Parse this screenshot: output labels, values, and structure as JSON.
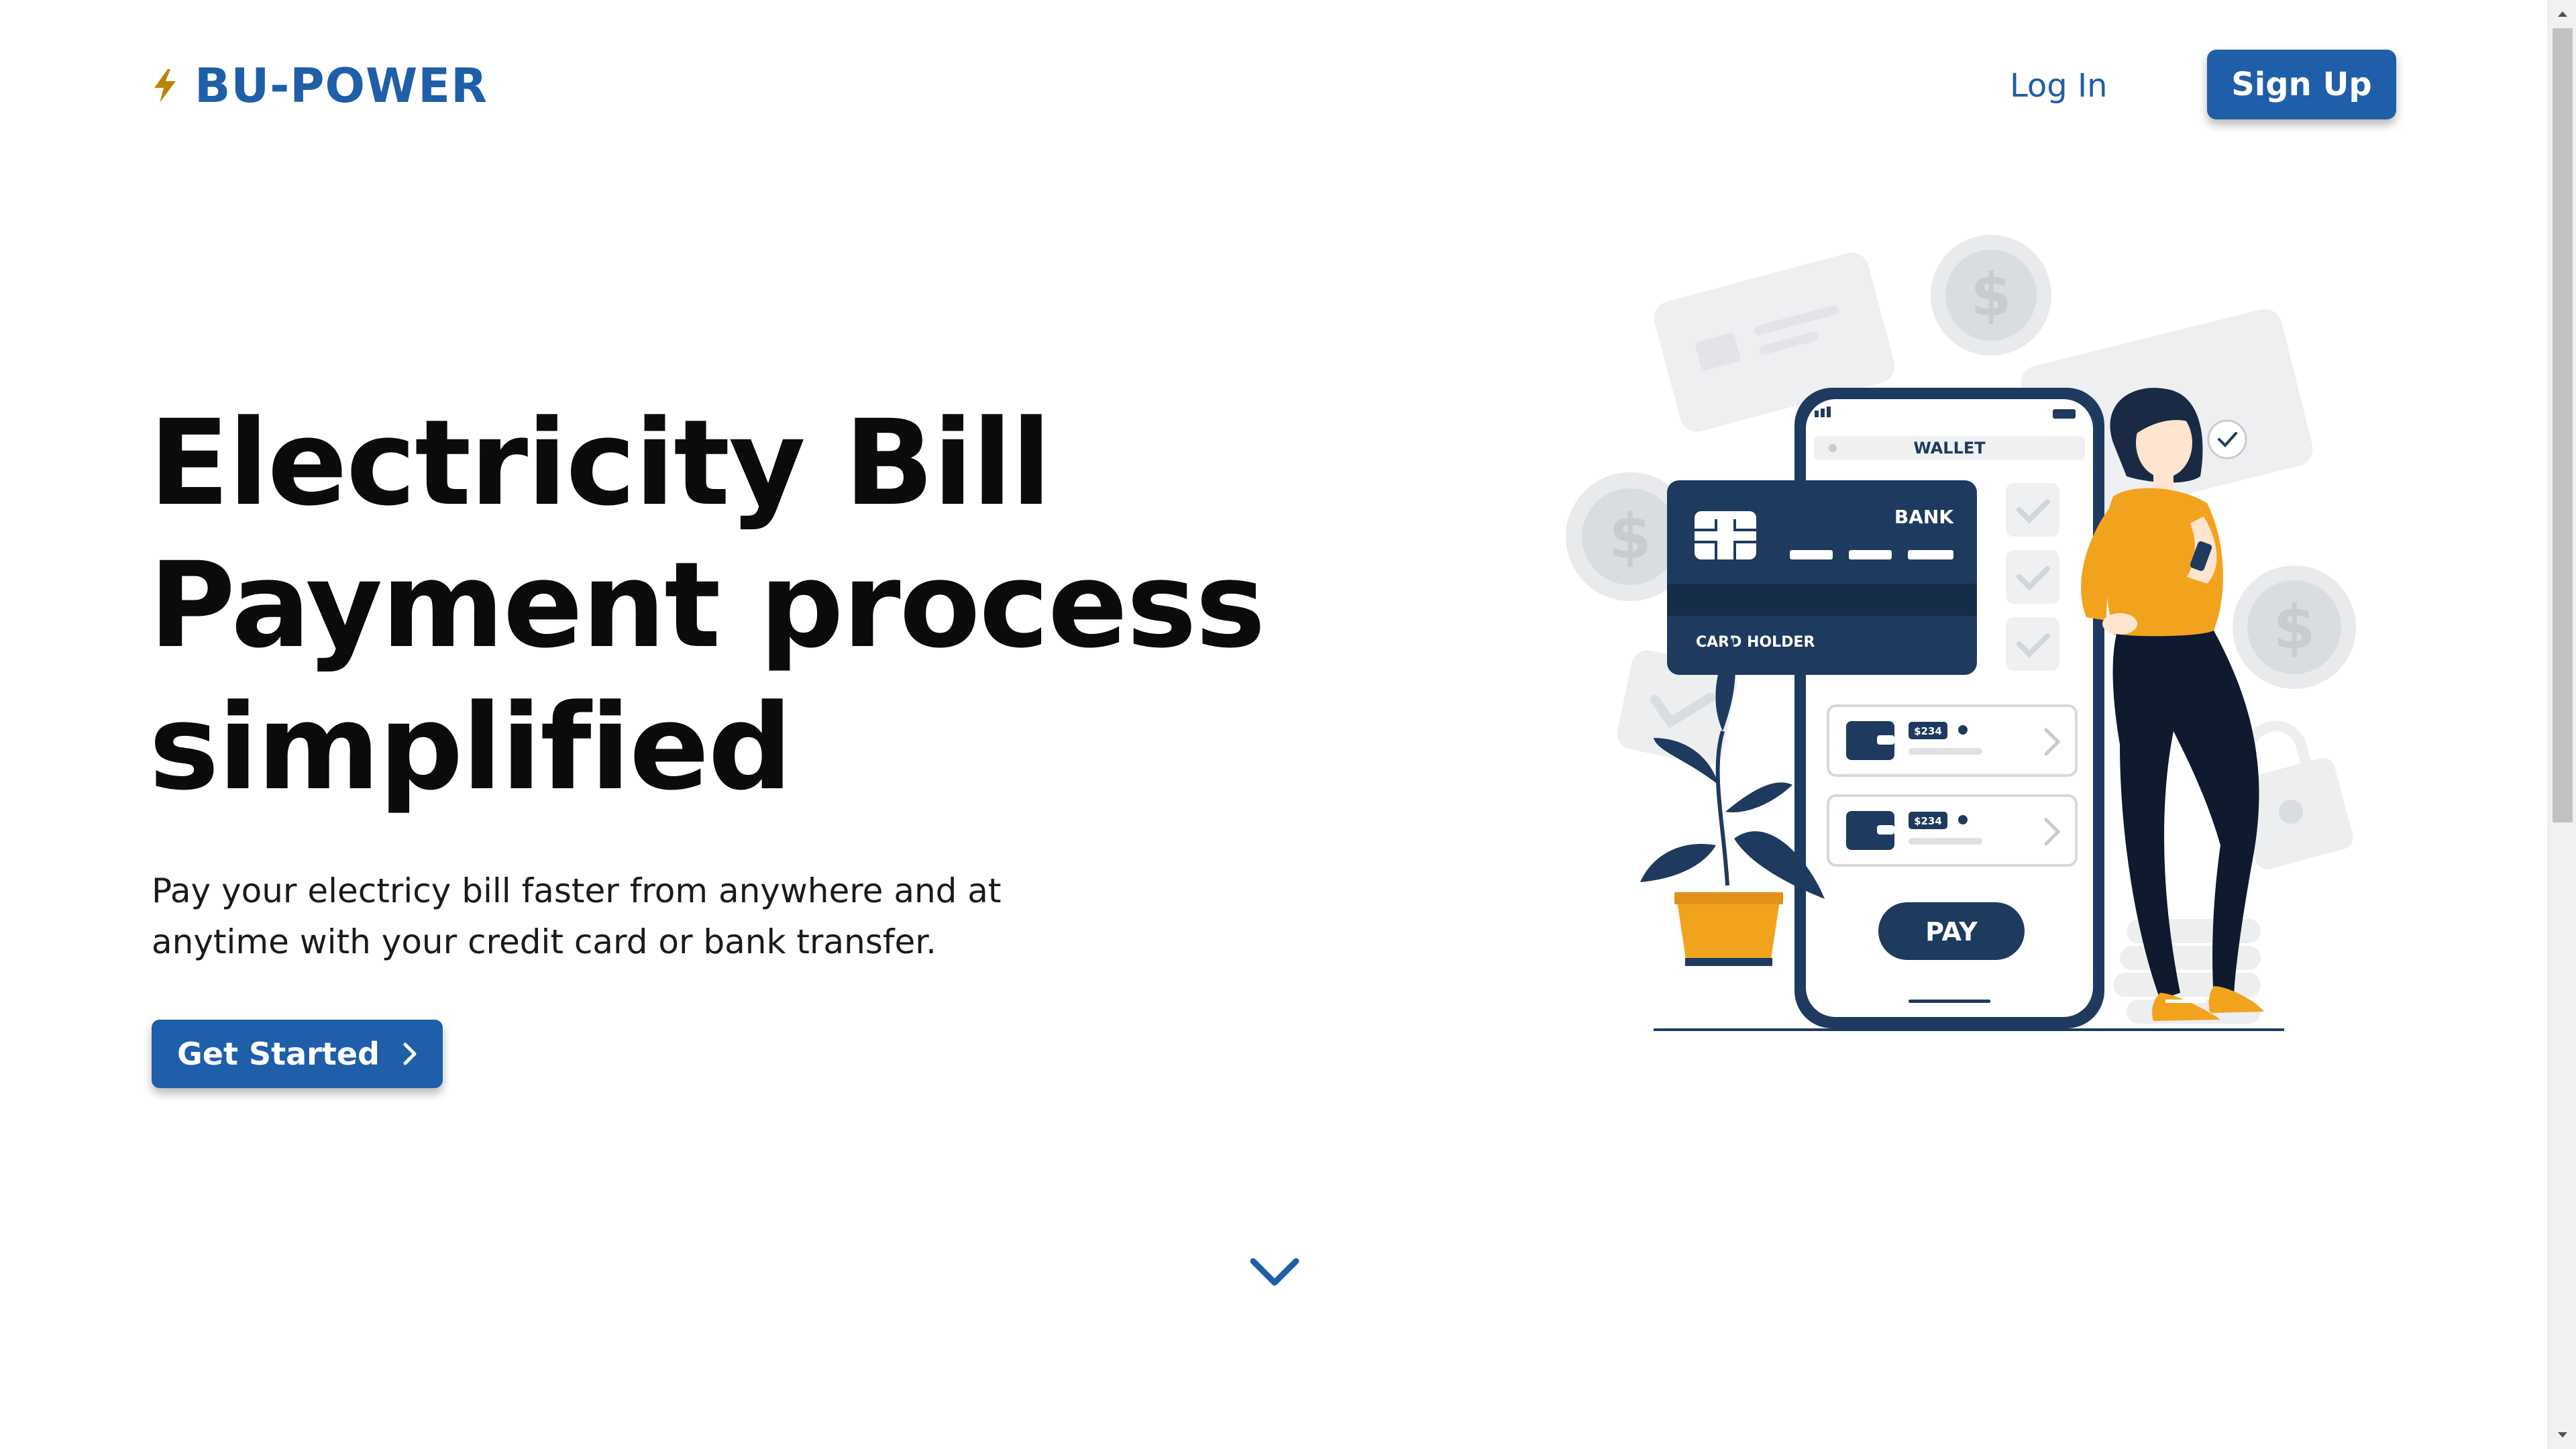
{
  "header": {
    "brand_name": "BU-POWER",
    "brand_icon": "lightning-bolt-icon",
    "login_label": "Log In",
    "signup_label": "Sign Up"
  },
  "hero": {
    "title_lines": [
      "Electricity Bill",
      "Payment process",
      "simplified"
    ],
    "subtitle_lines": [
      "Pay your electricy bill faster from anywhere and at",
      "anytime with your credit card or bank transfer."
    ],
    "cta_label": "Get Started",
    "cta_icon": "chevron-right-icon",
    "scroll_icon": "chevron-down-icon"
  },
  "illustration": {
    "wallet_label": "WALLET",
    "card_bank_label": "BANK",
    "card_holder_label": "CARD HOLDER",
    "transactions": [
      {
        "amount": "$234"
      },
      {
        "amount": "$234"
      }
    ],
    "pay_label": "PAY"
  },
  "colors": {
    "brand_blue": "#1f5ea8",
    "navy": "#1e3a5f",
    "accent_orange": "#f2a31e",
    "text_dark": "#0b0b0b",
    "bolt_gold": "#b8860b"
  }
}
